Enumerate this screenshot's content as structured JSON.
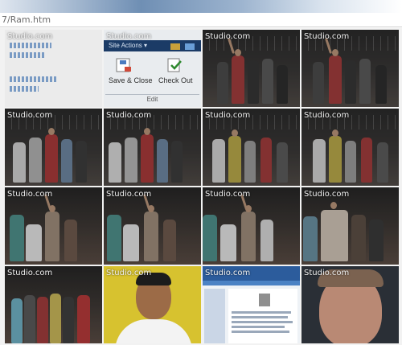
{
  "address_bar": {
    "text": "7/Ram.htm"
  },
  "watermark": "Studio.com",
  "sharepoint_tile": {
    "site_actions": "Site Actions ▾",
    "save_close": "Save & Close",
    "check_out": "Check Out",
    "group_label": "Edit"
  },
  "tile_count": 16,
  "colors": {
    "ribbon_dark": "#1b3b66",
    "portrait_bg": "#d7c22f",
    "tile_bg": "#303030"
  }
}
